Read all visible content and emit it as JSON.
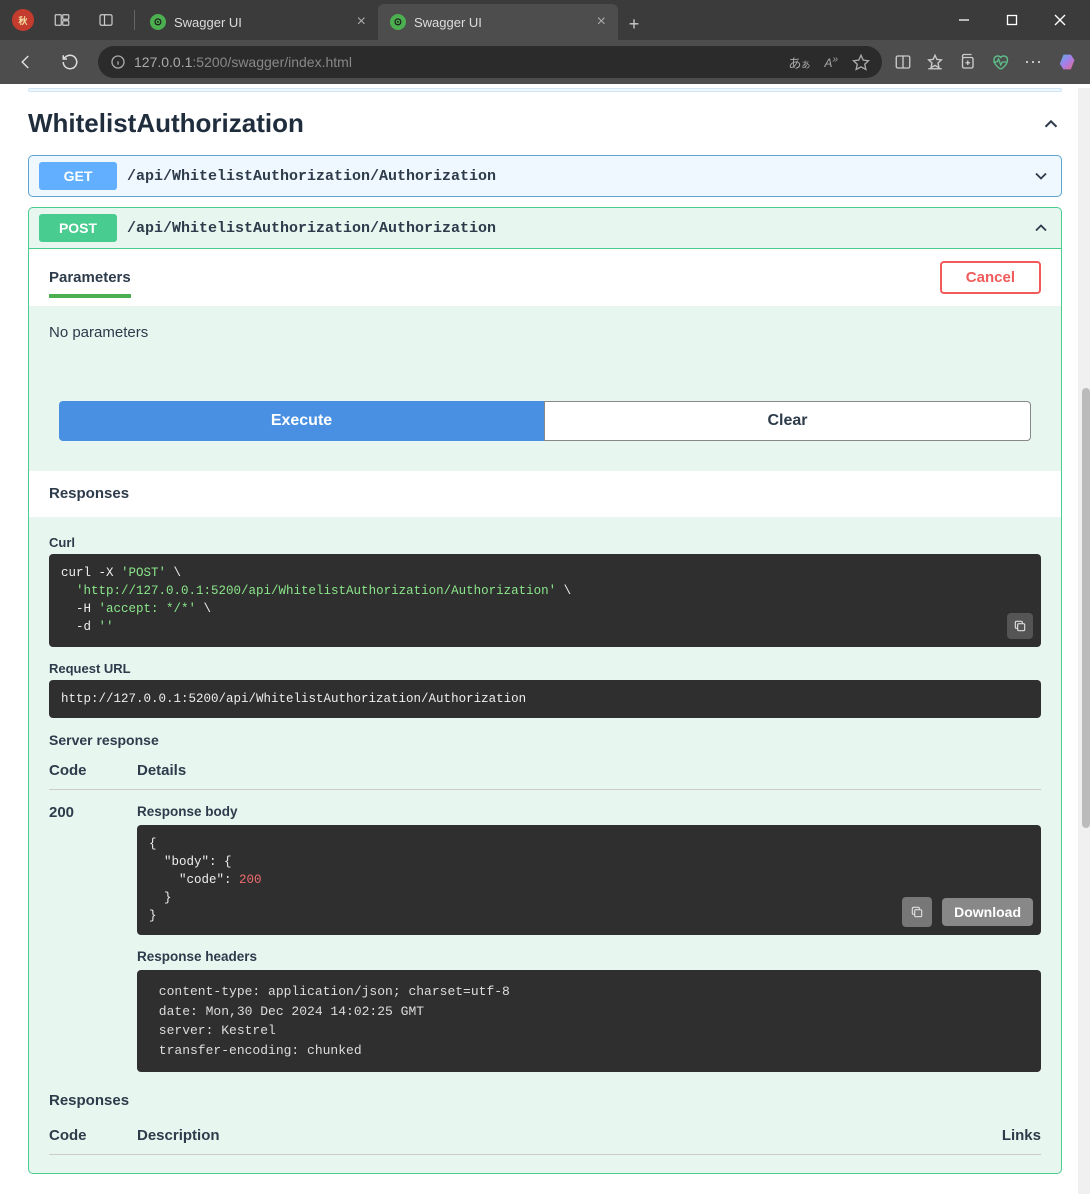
{
  "browser": {
    "tabs": [
      {
        "title": "Swagger UI",
        "active": false
      },
      {
        "title": "Swagger UI",
        "active": true
      }
    ],
    "url_host": "127.0.0.1",
    "url_port_path": ":5200/swagger/index.html"
  },
  "tag": {
    "name": "WhitelistAuthorization"
  },
  "operations": {
    "get": {
      "method": "GET",
      "path": "/api/WhitelistAuthorization/Authorization"
    },
    "post": {
      "method": "POST",
      "path": "/api/WhitelistAuthorization/Authorization",
      "parameters_label": "Parameters",
      "cancel_label": "Cancel",
      "no_params_text": "No parameters",
      "execute_label": "Execute",
      "clear_label": "Clear",
      "responses_label": "Responses",
      "curl_label": "Curl",
      "curl_line1a": "curl -X ",
      "curl_line1b": "'POST'",
      "curl_line1c": " \\",
      "curl_line2a": "  ",
      "curl_line2b": "'http://127.0.0.1:5200/api/WhitelistAuthorization/Authorization'",
      "curl_line2c": " \\",
      "curl_line3a": "  -H ",
      "curl_line3b": "'accept: */*'",
      "curl_line3c": " \\",
      "curl_line4a": "  -d ",
      "curl_line4b": "''",
      "request_url_label": "Request URL",
      "request_url": "http://127.0.0.1:5200/api/WhitelistAuthorization/Authorization",
      "server_response_label": "Server response",
      "table_code": "Code",
      "table_details": "Details",
      "resp_code": "200",
      "resp_body_label": "Response body",
      "resp_body_l1": "{",
      "resp_body_l2": "  \"body\": {",
      "resp_body_l3a": "    \"code\": ",
      "resp_body_l3b": "200",
      "resp_body_l4": "  }",
      "resp_body_l5": "}",
      "download_label": "Download",
      "resp_headers_label": "Response headers",
      "resp_headers_text": " content-type: application/json; charset=utf-8 \n date: Mon,30 Dec 2024 14:02:25 GMT \n server: Kestrel \n transfer-encoding: chunked ",
      "responses2_label": "Responses",
      "table2_code": "Code",
      "table2_desc": "Description",
      "table2_links": "Links"
    }
  }
}
